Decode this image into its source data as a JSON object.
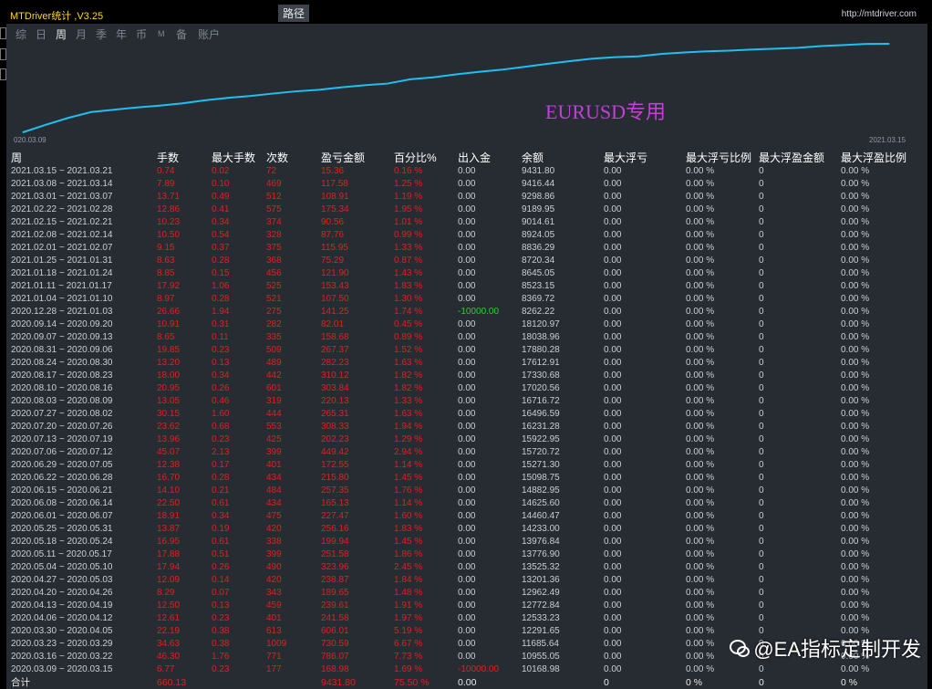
{
  "window": {
    "title": "MTDriver统计 ,V3.25",
    "url": "http://mtdriver.com"
  },
  "tabs": [
    {
      "label": "综",
      "active": false
    },
    {
      "label": "日",
      "active": false
    },
    {
      "label": "周",
      "active": true
    },
    {
      "label": "月",
      "active": false
    },
    {
      "label": "季",
      "active": false
    },
    {
      "label": "年",
      "active": false
    },
    {
      "label": "币",
      "active": false
    },
    {
      "label": "M",
      "active": false
    },
    {
      "label": "备",
      "active": false
    },
    {
      "label": "账户",
      "active": false
    }
  ],
  "path_tab": "路径",
  "chart": {
    "start_label": "020.03.09",
    "end_label": "2021.03.15",
    "annotation": "EURUSD专用",
    "line_color": "#1ec0f0"
  },
  "chart_data": {
    "type": "line",
    "x": [
      "2020.03.09",
      "2020.03.16",
      "2020.03.23",
      "2020.03.30",
      "2020.04.06",
      "2020.04.13",
      "2020.04.20",
      "2020.04.27",
      "2020.05.04",
      "2020.05.11",
      "2020.05.18",
      "2020.05.25",
      "2020.06.01",
      "2020.06.08",
      "2020.06.15",
      "2020.06.22",
      "2020.06.29",
      "2020.07.06",
      "2020.07.13",
      "2020.07.20",
      "2020.07.27",
      "2020.08.03",
      "2020.08.10",
      "2020.08.17",
      "2020.08.24",
      "2020.08.31",
      "2020.09.07",
      "2020.09.14",
      "2021.01.04",
      "2021.01.11",
      "2021.01.18",
      "2021.01.25",
      "2021.02.01",
      "2021.02.08",
      "2021.02.15",
      "2021.02.22",
      "2021.03.01",
      "2021.03.08",
      "2021.03.15"
    ],
    "values": [
      168.98,
      955.05,
      1685.64,
      2291.65,
      2533.23,
      2772.84,
      2962.49,
      3201.36,
      3525.32,
      3776.9,
      3976.84,
      4233.0,
      4460.47,
      4625.6,
      4882.95,
      5098.75,
      5271.3,
      5720.72,
      5922.95,
      6231.28,
      6496.59,
      6716.72,
      7020.56,
      7330.68,
      7612.91,
      7880.28,
      8038.96,
      8120.97,
      8369.72,
      8523.15,
      8645.05,
      8720.34,
      8836.29,
      8924.05,
      9014.61,
      9189.95,
      9298.86,
      9416.44,
      9431.8
    ]
  },
  "table": {
    "headers": [
      "周",
      "手数",
      "最大手数",
      "次数",
      "盈亏金额",
      "百分比%",
      "出入金",
      "余额",
      "最大浮亏",
      "最大浮亏比例",
      "最大浮盈金额",
      "最大浮盈比例"
    ],
    "rows": [
      [
        "2021.03.15 ~ 2021.03.21",
        "0.74",
        "0.02",
        "72",
        "15.36",
        "0.16 %",
        "0.00",
        "9431.80",
        "0.00",
        "0.00 %",
        "0",
        "0.00 %"
      ],
      [
        "2021.03.08 ~ 2021.03.14",
        "7.89",
        "0.10",
        "469",
        "117.58",
        "1.25 %",
        "0.00",
        "9416.44",
        "0.00",
        "0.00 %",
        "0",
        "0.00 %"
      ],
      [
        "2021.03.01 ~ 2021.03.07",
        "13.71",
        "0.49",
        "512",
        "108.91",
        "1.19 %",
        "0.00",
        "9298.86",
        "0.00",
        "0.00 %",
        "0",
        "0.00 %"
      ],
      [
        "2021.02.22 ~ 2021.02.28",
        "12.86",
        "0.41",
        "575",
        "175.34",
        "1.95 %",
        "0.00",
        "9189.95",
        "0.00",
        "0.00 %",
        "0",
        "0.00 %"
      ],
      [
        "2021.02.15 ~ 2021.02.21",
        "10.23",
        "0.34",
        "374",
        "90.56",
        "1.01 %",
        "0.00",
        "9014.61",
        "0.00",
        "0.00 %",
        "0",
        "0.00 %"
      ],
      [
        "2021.02.08 ~ 2021.02.14",
        "10.50",
        "0.54",
        "328",
        "87.76",
        "0.99 %",
        "0.00",
        "8924.05",
        "0.00",
        "0.00 %",
        "0",
        "0.00 %"
      ],
      [
        "2021.02.01 ~ 2021.02.07",
        "9.15",
        "0.37",
        "375",
        "115.95",
        "1.33 %",
        "0.00",
        "8836.29",
        "0.00",
        "0.00 %",
        "0",
        "0.00 %"
      ],
      [
        "2021.01.25 ~ 2021.01.31",
        "8.63",
        "0.28",
        "368",
        "75.29",
        "0.87 %",
        "0.00",
        "8720.34",
        "0.00",
        "0.00 %",
        "0",
        "0.00 %"
      ],
      [
        "2021.01.18 ~ 2021.01.24",
        "8.85",
        "0.15",
        "456",
        "121.90",
        "1.43 %",
        "0.00",
        "8645.05",
        "0.00",
        "0.00 %",
        "0",
        "0.00 %"
      ],
      [
        "2021.01.11 ~ 2021.01.17",
        "17.92",
        "1.06",
        "525",
        "153.43",
        "1.83 %",
        "0.00",
        "8523.15",
        "0.00",
        "0.00 %",
        "0",
        "0.00 %"
      ],
      [
        "2021.01.04 ~ 2021.01.10",
        "8.97",
        "0.28",
        "521",
        "107.50",
        "1.30 %",
        "0.00",
        "8369.72",
        "0.00",
        "0.00 %",
        "0",
        "0.00 %"
      ],
      [
        "2020.12.28 ~ 2021.01.03",
        "26.66",
        "1.94",
        "275",
        "141.25",
        "1.74 %",
        "-10000.00",
        "8262.22",
        "0.00",
        "0.00 %",
        "0",
        "0.00 %"
      ],
      [
        "2020.09.14 ~ 2020.09.20",
        "10.91",
        "0.31",
        "282",
        "82.01",
        "0.45 %",
        "0.00",
        "18120.97",
        "0.00",
        "0.00 %",
        "0",
        "0.00 %"
      ],
      [
        "2020.09.07 ~ 2020.09.13",
        "8.65",
        "0.11",
        "335",
        "158.68",
        "0.89 %",
        "0.00",
        "18038.96",
        "0.00",
        "0.00 %",
        "0",
        "0.00 %"
      ],
      [
        "2020.08.31 ~ 2020.09.06",
        "19.85",
        "0.23",
        "509",
        "267.37",
        "1.52 %",
        "0.00",
        "17880.28",
        "0.00",
        "0.00 %",
        "0",
        "0.00 %"
      ],
      [
        "2020.08.24 ~ 2020.08.30",
        "13.20",
        "0.13",
        "489",
        "282.23",
        "1.63 %",
        "0.00",
        "17612.91",
        "0.00",
        "0.00 %",
        "0",
        "0.00 %"
      ],
      [
        "2020.08.17 ~ 2020.08.23",
        "18.00",
        "0.34",
        "442",
        "310.12",
        "1.82 %",
        "0.00",
        "17330.68",
        "0.00",
        "0.00 %",
        "0",
        "0.00 %"
      ],
      [
        "2020.08.10 ~ 2020.08.16",
        "20.95",
        "0.26",
        "601",
        "303.84",
        "1.82 %",
        "0.00",
        "17020.56",
        "0.00",
        "0.00 %",
        "0",
        "0.00 %"
      ],
      [
        "2020.08.03 ~ 2020.08.09",
        "13.05",
        "0.46",
        "319",
        "220.13",
        "1.33 %",
        "0.00",
        "16716.72",
        "0.00",
        "0.00 %",
        "0",
        "0.00 %"
      ],
      [
        "2020.07.27 ~ 2020.08.02",
        "30.15",
        "1.60",
        "444",
        "265.31",
        "1.63 %",
        "0.00",
        "16496.59",
        "0.00",
        "0.00 %",
        "0",
        "0.00 %"
      ],
      [
        "2020.07.20 ~ 2020.07.26",
        "23.62",
        "0.68",
        "553",
        "308.33",
        "1.94 %",
        "0.00",
        "16231.28",
        "0.00",
        "0.00 %",
        "0",
        "0.00 %"
      ],
      [
        "2020.07.13 ~ 2020.07.19",
        "13.96",
        "0.23",
        "425",
        "202.23",
        "1.29 %",
        "0.00",
        "15922.95",
        "0.00",
        "0.00 %",
        "0",
        "0.00 %"
      ],
      [
        "2020.07.06 ~ 2020.07.12",
        "45.07",
        "2.13",
        "399",
        "449.42",
        "2.94 %",
        "0.00",
        "15720.72",
        "0.00",
        "0.00 %",
        "0",
        "0.00 %"
      ],
      [
        "2020.06.29 ~ 2020.07.05",
        "12.38",
        "0.17",
        "401",
        "172.55",
        "1.14 %",
        "0.00",
        "15271.30",
        "0.00",
        "0.00 %",
        "0",
        "0.00 %"
      ],
      [
        "2020.06.22 ~ 2020.06.28",
        "16.70",
        "0.28",
        "434",
        "215.80",
        "1.45 %",
        "0.00",
        "15098.75",
        "0.00",
        "0.00 %",
        "0",
        "0.00 %"
      ],
      [
        "2020.06.15 ~ 2020.06.21",
        "14.10",
        "0.21",
        "484",
        "257.35",
        "1.76 %",
        "0.00",
        "14882.95",
        "0.00",
        "0.00 %",
        "0",
        "0.00 %"
      ],
      [
        "2020.06.08 ~ 2020.06.14",
        "22.50",
        "0.61",
        "434",
        "165.13",
        "1.14 %",
        "0.00",
        "14625.60",
        "0.00",
        "0.00 %",
        "0",
        "0.00 %"
      ],
      [
        "2020.06.01 ~ 2020.06.07",
        "18.91",
        "0.34",
        "475",
        "227.47",
        "1.60 %",
        "0.00",
        "14460.47",
        "0.00",
        "0.00 %",
        "0",
        "0.00 %"
      ],
      [
        "2020.05.25 ~ 2020.05.31",
        "13.87",
        "0.19",
        "420",
        "256.16",
        "1.83 %",
        "0.00",
        "14233.00",
        "0.00",
        "0.00 %",
        "0",
        "0.00 %"
      ],
      [
        "2020.05.18 ~ 2020.05.24",
        "16.95",
        "0.61",
        "338",
        "199.94",
        "1.45 %",
        "0.00",
        "13976.84",
        "0.00",
        "0.00 %",
        "0",
        "0.00 %"
      ],
      [
        "2020.05.11 ~ 2020.05.17",
        "17.88",
        "0.51",
        "399",
        "251.58",
        "1.86 %",
        "0.00",
        "13776.90",
        "0.00",
        "0.00 %",
        "0",
        "0.00 %"
      ],
      [
        "2020.05.04 ~ 2020.05.10",
        "17.94",
        "0.26",
        "490",
        "323.96",
        "2.45 %",
        "0.00",
        "13525.32",
        "0.00",
        "0.00 %",
        "0",
        "0.00 %"
      ],
      [
        "2020.04.27 ~ 2020.05.03",
        "12.09",
        "0.14",
        "420",
        "238.87",
        "1.84 %",
        "0.00",
        "13201.36",
        "0.00",
        "0.00 %",
        "0",
        "0.00 %"
      ],
      [
        "2020.04.20 ~ 2020.04.26",
        "8.29",
        "0.07",
        "343",
        "189.65",
        "1.48 %",
        "0.00",
        "12962.49",
        "0.00",
        "0.00 %",
        "0",
        "0.00 %"
      ],
      [
        "2020.04.13 ~ 2020.04.19",
        "12.50",
        "0.13",
        "459",
        "239.61",
        "1.91 %",
        "0.00",
        "12772.84",
        "0.00",
        "0.00 %",
        "0",
        "0.00 %"
      ],
      [
        "2020.04.06 ~ 2020.04.12",
        "12.61",
        "0.23",
        "401",
        "241.58",
        "1.97 %",
        "0.00",
        "12533.23",
        "0.00",
        "0.00 %",
        "0",
        "0.00 %"
      ],
      [
        "2020.03.30 ~ 2020.04.05",
        "22.19",
        "0.38",
        "613",
        "606.01",
        "5.19 %",
        "0.00",
        "12291.65",
        "0.00",
        "0.00 %",
        "0",
        "0.00 %"
      ],
      [
        "2020.03.23 ~ 2020.03.29",
        "34.63",
        "0.38",
        "1009",
        "730.59",
        "6.67 %",
        "0.00",
        "11685.64",
        "0.00",
        "0.00 %",
        "0",
        "0.00 %"
      ],
      [
        "2020.03.16 ~ 2020.03.22",
        "46.30",
        "1.76",
        "771",
        "786.07",
        "7.73 %",
        "0.00",
        "10955.05",
        "0.00",
        "0.00 %",
        "0",
        "0.00 %"
      ],
      [
        "2020.03.09 ~ 2020.03.15",
        "6.77",
        "0.23",
        "177",
        "168.98",
        "1.69 %",
        "-10000.00",
        "10168.98",
        "0.00",
        "0.00 %",
        "0",
        "0.00 %"
      ]
    ],
    "total": [
      "合计",
      "660.13",
      "",
      "",
      "9431.80",
      "75.50 %",
      "0.00",
      "",
      "0",
      "0 %",
      "0",
      "0 %"
    ]
  },
  "watermark": "@EA指标定制开发"
}
